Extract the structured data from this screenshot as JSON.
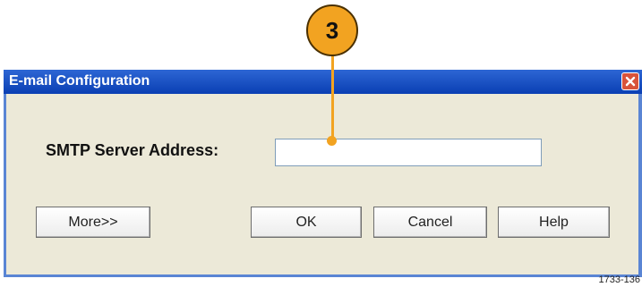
{
  "dialog": {
    "title": "E-mail Configuration",
    "smtp_label": "SMTP Server Address:",
    "smtp_value": "",
    "buttons": {
      "more": "More>>",
      "ok": "OK",
      "cancel": "Cancel",
      "help": "Help"
    },
    "close_icon": "close-icon"
  },
  "callout": {
    "number": "3",
    "color": "#f2a321"
  },
  "figure_id": "1733-136",
  "colors": {
    "titlebar": "#0a3fb3",
    "client_bg": "#ece9d8",
    "close_button": "#d8533b"
  }
}
